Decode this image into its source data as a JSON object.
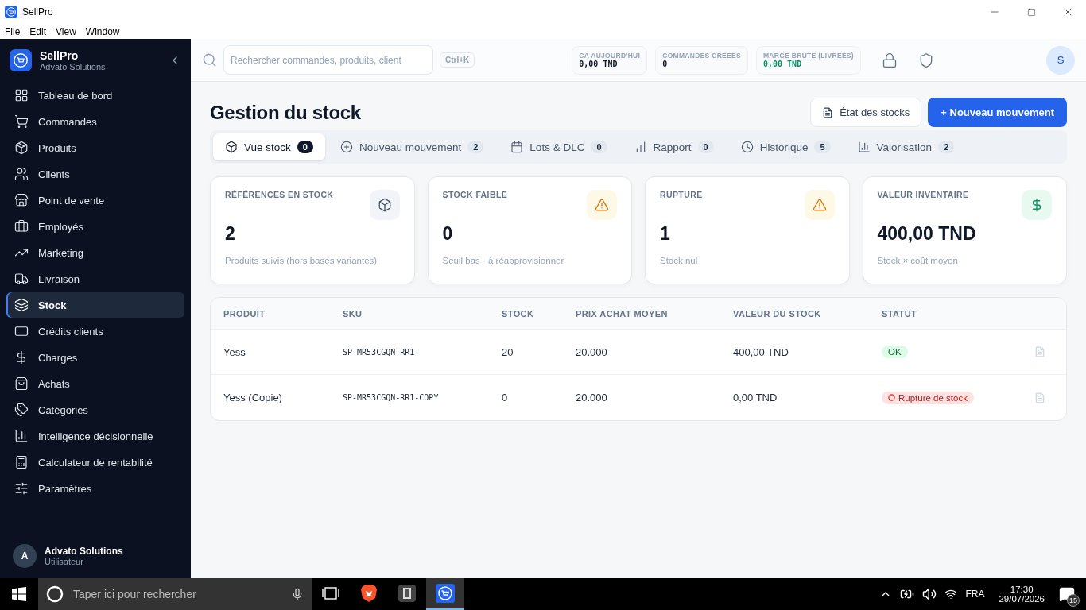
{
  "window": {
    "title": "SellPro"
  },
  "menu": [
    "File",
    "Edit",
    "View",
    "Window"
  ],
  "sidebar": {
    "brand": "SellPro",
    "company": "Advato Solutions",
    "items": [
      {
        "label": "Tableau de bord",
        "selected": false
      },
      {
        "label": "Commandes",
        "selected": false
      },
      {
        "label": "Produits",
        "selected": false
      },
      {
        "label": "Clients",
        "selected": false
      },
      {
        "label": "Point de vente",
        "selected": false
      },
      {
        "label": "Employés",
        "selected": false
      },
      {
        "label": "Marketing",
        "selected": false
      },
      {
        "label": "Livraison",
        "selected": false
      },
      {
        "label": "Stock",
        "selected": true
      },
      {
        "label": "Crédits clients",
        "selected": false
      },
      {
        "label": "Charges",
        "selected": false
      },
      {
        "label": "Achats",
        "selected": false
      },
      {
        "label": "Catégories",
        "selected": false
      },
      {
        "label": "Intelligence décisionnelle",
        "selected": false
      },
      {
        "label": "Calculateur de rentabilité",
        "selected": false
      },
      {
        "label": "Paramètres",
        "selected": false
      }
    ],
    "user": {
      "initial": "A",
      "name": "Advato Solutions",
      "role": "Utilisateur"
    }
  },
  "topbar": {
    "search": {
      "placeholder": "Rechercher commandes, produits, client"
    },
    "shortcut": "Ctrl+K",
    "stats": [
      {
        "label": "CA AUJOURD'HUI",
        "value": "0,00 TND",
        "positive": false
      },
      {
        "label": "COMMANDES CRÉÉES",
        "value": "0",
        "positive": false
      },
      {
        "label": "MARGE BRUTE (LIVRÉES)",
        "value": "0,00 TND",
        "positive": true
      }
    ],
    "avatar": "S"
  },
  "page": {
    "title": "Gestion du stock",
    "secondary_button": "État des stocks",
    "primary_button": "+ Nouveau mouvement"
  },
  "tabs": [
    {
      "label": "Vue stock",
      "count": "0",
      "selected": true
    },
    {
      "label": "Nouveau mouvement",
      "count": "2",
      "selected": false
    },
    {
      "label": "Lots & DLC",
      "count": "0",
      "selected": false
    },
    {
      "label": "Rapport",
      "count": "0",
      "selected": false
    },
    {
      "label": "Historique",
      "count": "5",
      "selected": false
    },
    {
      "label": "Valorisation",
      "count": "2",
      "selected": false
    }
  ],
  "cards": [
    {
      "kind": "box",
      "label": "RÉFÉRENCES EN STOCK",
      "value": "2",
      "note": "Produits suivis (hors bases variantes)"
    },
    {
      "kind": "warning",
      "label": "STOCK FAIBLE",
      "value": "0",
      "note": "Seuil bas · à réapprovisionner"
    },
    {
      "kind": "warning",
      "label": "RUPTURE",
      "value": "1",
      "note": "Stock nul"
    },
    {
      "kind": "money",
      "label": "VALEUR INVENTAIRE",
      "value": "400,00 TND",
      "note": "Stock × coût moyen"
    }
  ],
  "table": {
    "columns": [
      "PRODUIT",
      "SKU",
      "STOCK",
      "PRIX ACHAT MOYEN",
      "VALEUR DU STOCK",
      "STATUT"
    ],
    "rows": [
      {
        "product": "Yess",
        "sku": "SP-MR53CGQN-RR1",
        "stock": "20",
        "price": "20.000",
        "value": "400,00 TND",
        "status": "OK",
        "kind": "ok"
      },
      {
        "product": "Yess (Copie)",
        "sku": "SP-MR53CGQN-RR1-COPY",
        "stock": "0",
        "price": "20.000",
        "value": "0,00 TND",
        "status": "Rupture de stock",
        "kind": "out"
      }
    ]
  },
  "taskbar": {
    "search": {
      "placeholder": "Taper ici pour rechercher"
    },
    "language": "FRA",
    "time": "17:30",
    "date": "29/07/2026",
    "notifications": "15"
  }
}
